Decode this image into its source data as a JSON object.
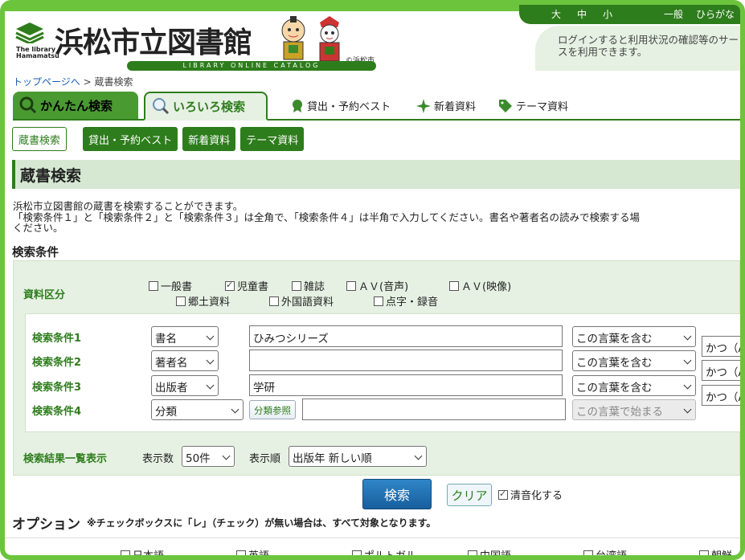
{
  "header": {
    "font_size_options": [
      "大",
      "中",
      "小"
    ],
    "display_options": [
      "一般",
      "ひらがな"
    ],
    "login_notice": "ログインすると利用状況の確認等のサービスを利用できます。",
    "logo_en": "The library Hamamatsu",
    "logo_title": "浜松市立図書館",
    "logo_subtitle": "LIBRARY ONLINE CATALOG",
    "copyright": "©浜松市"
  },
  "breadcrumb": {
    "home": "トップページへ",
    "separator": ">",
    "current": "蔵書検索"
  },
  "tabs": {
    "simple": "かんたん検索",
    "various": "いろいろ検索",
    "links": [
      "貸出・予約ベスト",
      "新着資料",
      "テーマ資料"
    ]
  },
  "subnav": [
    "蔵書検索",
    "貸出・予約ベスト",
    "新着資料",
    "テーマ資料"
  ],
  "page_title": "蔵書検索",
  "description": [
    "浜松市立図書館の蔵書を検索することができます。",
    "「検索条件１」と「検索条件２」と「検索条件３」は全角で、「検索条件４」は半角で入力してください。書名や著者名の読みで検索する場",
    "ください。"
  ],
  "section_title": "検索条件",
  "material": {
    "label": "資料区分",
    "options": [
      {
        "label": "一般書",
        "checked": false
      },
      {
        "label": "児童書",
        "checked": true
      },
      {
        "label": "雑誌",
        "checked": false
      },
      {
        "label": "ＡＶ(音声)",
        "checked": false
      },
      {
        "label": "ＡＶ(映像)",
        "checked": false
      },
      {
        "label": "郷土資料",
        "checked": false
      },
      {
        "label": "外国語資料",
        "checked": false
      },
      {
        "label": "点字・録音",
        "checked": false
      }
    ]
  },
  "conditions": [
    {
      "label": "検索条件1",
      "field": "書名",
      "value": "ひみつシリーズ",
      "match": "この言葉を含む",
      "join": "かつ（A"
    },
    {
      "label": "検索条件2",
      "field": "著者名",
      "value": "",
      "match": "この言葉を含む",
      "join": "かつ（A"
    },
    {
      "label": "検索条件3",
      "field": "出版者",
      "value": "学研",
      "match": "この言葉を含む",
      "join": "かつ（A"
    },
    {
      "label": "検索条件4",
      "field": "分類",
      "value": "",
      "match": "この言葉で始まる",
      "ref_button": "分類参照"
    }
  ],
  "results": {
    "label": "検索結果一覧表示",
    "count_label": "表示数",
    "count_value": "50件",
    "order_label": "表示順",
    "order_value": "出版年 新しい順"
  },
  "actions": {
    "search": "検索",
    "clear": "クリア",
    "voiced": "清音化する"
  },
  "options": {
    "title": "オプション",
    "note": "※チェックボックスに「レ」（チェック）が無い場合は、すべて対象となります。",
    "languages": [
      "日本語",
      "英語",
      "ポルトガル",
      "中国語",
      "台湾語",
      "朝鮮"
    ]
  },
  "colors": {
    "accent": "#2e7d1c",
    "frame": "#6cc43c",
    "panel": "#e6f1e3",
    "search_button": "#185e9c"
  }
}
